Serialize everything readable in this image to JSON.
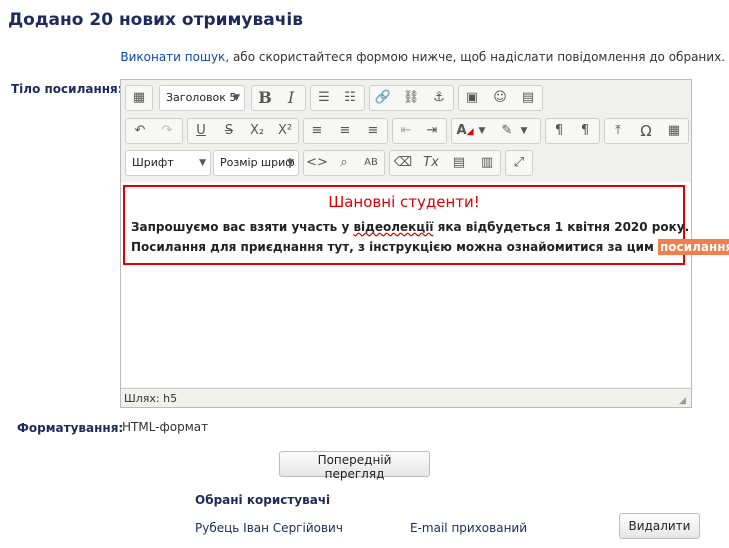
{
  "page": {
    "title": "Додано 20 нових отримувачів",
    "search_link": "Виконати пошук",
    "search_rest": ", або скористайтеся формою нижче, щоб надіслати повідомлення до обраних."
  },
  "form": {
    "body_label": "Тіло посилання:",
    "format_label": "Форматування:",
    "format_value": "HTML-формат",
    "preview_button": "Попередній перегляд",
    "delete_button": "Видалити"
  },
  "editor": {
    "format_select": "Заголовок 5",
    "font_select": "Шрифт",
    "size_select": "Розмір шриф",
    "path_label": "Шлях: h5",
    "content": {
      "greeting": "Шановні студенти!",
      "line1_a": "Запрошуємо вас взяти участь у ",
      "line1_word": "відеолекції",
      "line1_b": " яка відбудеться 1 квітня 2020 року.",
      "line2_a": "Посилання для приєднання тут, з інструкцією можна ознайомитися за цим ",
      "line2_link": "посиланням"
    },
    "colors": {
      "accent_red": "#e00000",
      "highlight": "#f07f4f"
    }
  },
  "users": {
    "heading": "Обрані користувачі",
    "items": [
      {
        "name": "Рубець Іван Сергійович",
        "email": "E-mail прихований"
      }
    ]
  },
  "toolbar_icons": {
    "r1": [
      "toggle-toolbar-icon",
      "bold-icon",
      "italic-icon",
      "bullet-list-icon",
      "numbered-list-icon",
      "link-icon",
      "unlink-icon",
      "anchor-icon",
      "image-icon",
      "emoticon-icon",
      "media-icon"
    ],
    "r2": [
      "undo-icon",
      "redo-icon",
      "underline-icon",
      "strikethrough-icon",
      "subscript-icon",
      "superscript-icon",
      "align-left-icon",
      "align-center-icon",
      "align-right-icon",
      "outdent-icon",
      "indent-icon",
      "text-color-icon",
      "highlight-color-icon",
      "ltr-icon",
      "rtl-icon",
      "upload-icon",
      "special-char-icon",
      "table-icon"
    ],
    "r3": [
      "code-icon",
      "find-icon",
      "spellcheck-icon",
      "clear-format-icon",
      "remove-format-icon",
      "paste-text-icon",
      "paste-word-icon",
      "fullscreen-icon"
    ]
  }
}
